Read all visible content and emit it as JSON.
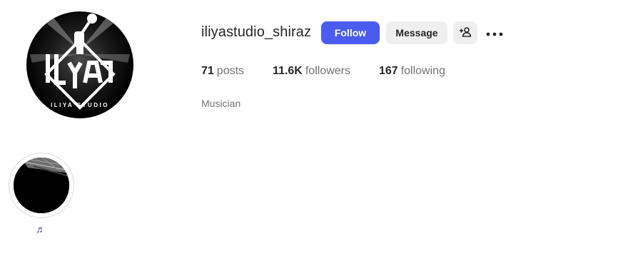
{
  "profile": {
    "username": "iliyastudio_shiraz",
    "category": "Musician",
    "avatar_text": "ILIYA STUDIO",
    "avatar_mark": "ILYA"
  },
  "actions": {
    "follow_label": "Follow",
    "message_label": "Message",
    "add_user_icon": "person-add-icon",
    "more_icon": "more-horizontal-icon"
  },
  "stats": {
    "posts_count": "71",
    "posts_label": "posts",
    "followers_count": "11.6K",
    "followers_label": "followers",
    "following_count": "167",
    "following_label": "following"
  },
  "highlights": [
    {
      "label": "♬",
      "icon": "music-note-icon"
    }
  ],
  "colors": {
    "accent": "#4a5cf0",
    "secondary_button": "#efefef",
    "muted_text": "#737373",
    "primary_text": "#262626"
  }
}
